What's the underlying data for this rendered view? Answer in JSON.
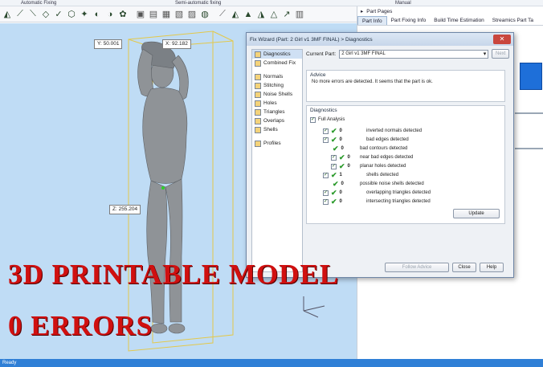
{
  "ribbon": {
    "group_automatic": "Automatic Fixing",
    "group_semi": "Semi-automatic fixing",
    "group_manual": "Manual"
  },
  "viewport": {
    "coord_y": "Y: 50.001",
    "coord_x": "X: 92.182",
    "coord_z": "Z: 255.204"
  },
  "right_panel": {
    "header": "Part Pages",
    "tabs": [
      "Part Info",
      "Part Fixing Info",
      "Build Time Estimation",
      "Streamics Part Ta"
    ]
  },
  "dialog": {
    "title": "Fix Wizard (Part: 2 Girl v1 3MF FINAL) > Diagnostics",
    "nav_top": [
      "Diagnostics",
      "Combined Fix"
    ],
    "nav_mid": [
      "Normals",
      "Stitching",
      "Noise Shells",
      "Holes",
      "Triangles",
      "Overlaps",
      "Shells"
    ],
    "nav_bottom": [
      "Profiles"
    ],
    "current_part_label": "Current Part:",
    "current_part_value": "2 Girl v1 3MF FINAL",
    "next_button": "Next",
    "advice_title": "Advice",
    "advice_text": "No more errors are detected. It seems that the part is ok.",
    "diagnostics_title": "Diagnostics",
    "full_analysis": "Full Analysis",
    "rows": [
      {
        "count": "0",
        "label": "inverted normals detected"
      },
      {
        "count": "0",
        "label": "bad edges detected"
      },
      {
        "count": "0",
        "label": "bad contours detected"
      },
      {
        "count": "0",
        "label": "near bad edges detected"
      },
      {
        "count": "0",
        "label": "planar holes detected"
      },
      {
        "count": "1",
        "label": "shells detected"
      },
      {
        "count": "0",
        "label": "possible noise shells detected"
      },
      {
        "count": "0",
        "label": "overlapping triangles detected"
      },
      {
        "count": "0",
        "label": "intersecting triangles detected"
      }
    ],
    "update_button": "Update",
    "follow_advice_button": "Follow Advice",
    "close_button": "Close",
    "help_button": "Help"
  },
  "overlay": {
    "line1": "3D PRINTABLE MODEL",
    "line2": "0 ERRORS"
  },
  "status": {
    "text": "Ready"
  },
  "colors": {
    "viewport_bg": "#bfdcf5",
    "overlay_text": "#d01010",
    "status_bar": "#2f7fd6",
    "check": "#2b9a2b"
  }
}
